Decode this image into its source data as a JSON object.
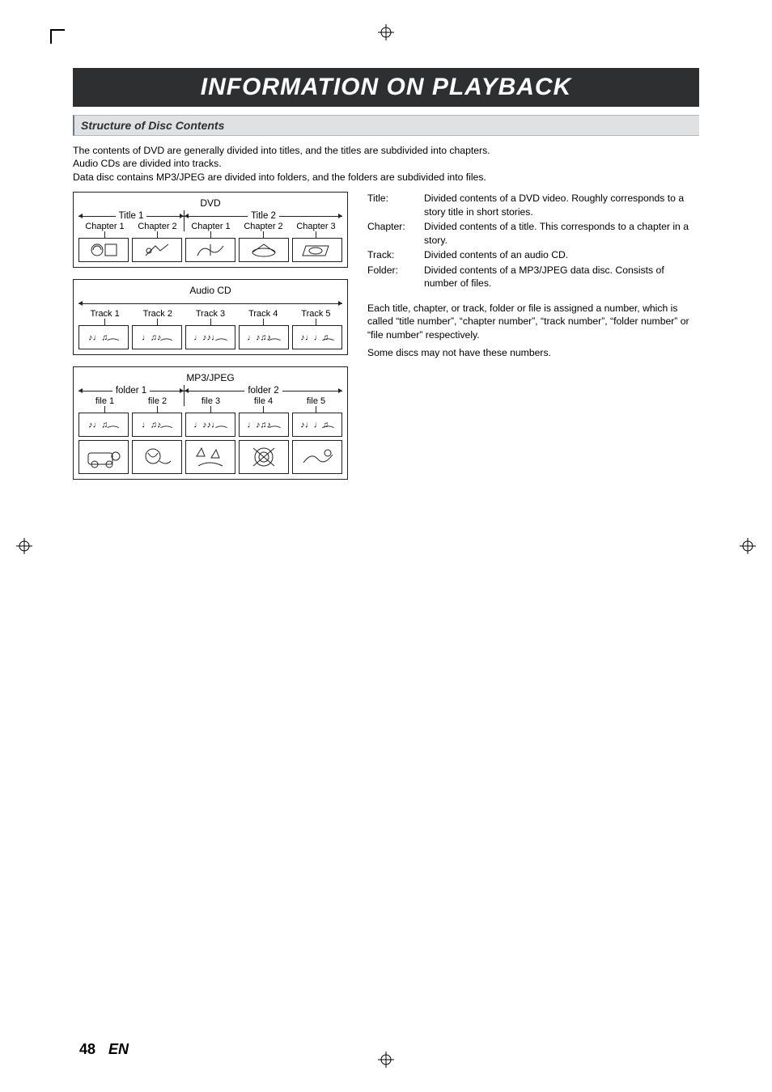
{
  "page": {
    "title": "INFORMATION ON PLAYBACK",
    "section_head": "Structure of Disc Contents",
    "intro_line1": "The contents of DVD are generally divided into titles, and the titles are subdivided into chapters.",
    "intro_line2": "Audio CDs are divided into tracks.",
    "intro_line3": "Data disc contains MP3/JPEG are divided into folders, and the folders are subdivided into files.",
    "page_number": "48",
    "language": "EN"
  },
  "diagrams": {
    "dvd": {
      "title": "DVD",
      "group1_label": "Title 1",
      "group2_label": "Title 2",
      "cells": [
        "Chapter 1",
        "Chapter 2",
        "Chapter 1",
        "Chapter 2",
        "Chapter 3"
      ]
    },
    "audiocd": {
      "title": "Audio CD",
      "cells": [
        "Track 1",
        "Track 2",
        "Track 3",
        "Track 4",
        "Track 5"
      ]
    },
    "mp3jpeg": {
      "title": "MP3/JPEG",
      "group1_label": "folder 1",
      "group2_label": "folder 2",
      "cells": [
        "file 1",
        "file 2",
        "file 3",
        "file 4",
        "file 5"
      ]
    }
  },
  "definitions": {
    "title_label": "Title:",
    "title_text": "Divided contents of a DVD video. Roughly corresponds to a story title in short stories.",
    "chapter_label": "Chapter:",
    "chapter_text": "Divided contents of a title. This corresponds to a chapter in a story.",
    "track_label": "Track:",
    "track_text": "Divided contents of an audio CD.",
    "folder_label": "Folder:",
    "folder_text": "Divided contents of a MP3/JPEG data disc. Consists of number of files."
  },
  "notes": {
    "n1": "Each title, chapter, or track, folder or file is assigned a number, which is called “title number”, “chapter number”, “track number”, “folder number” or “file number” respectively.",
    "n2": "Some discs may not have these numbers."
  }
}
